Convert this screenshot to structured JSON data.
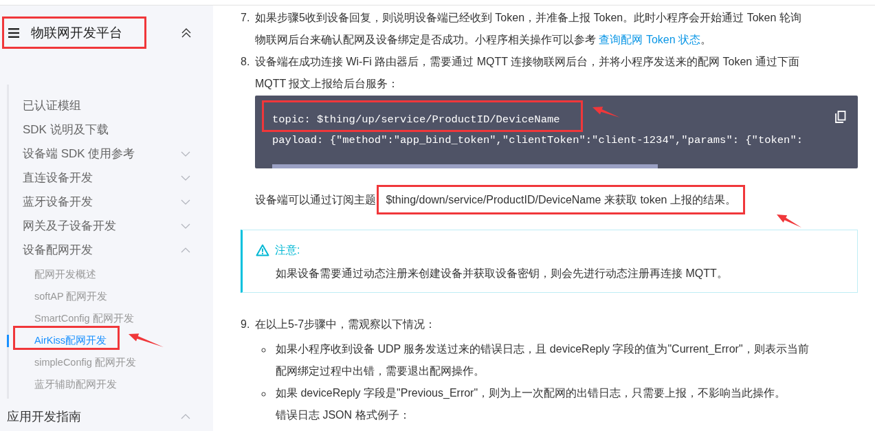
{
  "sidebar": {
    "title": "物联网开发平台",
    "expanded": true,
    "items": [
      {
        "kind": "link",
        "label": "已认证模组"
      },
      {
        "kind": "link",
        "label": "SDK 说明及下载"
      },
      {
        "kind": "group",
        "label": "设备端 SDK 使用参考",
        "expanded": false
      },
      {
        "kind": "group",
        "label": "直连设备开发",
        "expanded": false
      },
      {
        "kind": "group",
        "label": "蓝牙设备开发",
        "expanded": false
      },
      {
        "kind": "group",
        "label": "网关及子设备开发",
        "expanded": false
      },
      {
        "kind": "group",
        "label": "设备配网开发",
        "expanded": true,
        "children": [
          {
            "label": "配网开发概述",
            "selected": false
          },
          {
            "label": "softAP 配网开发",
            "selected": false
          },
          {
            "label": "SmartConfig 配网开发",
            "selected": false
          },
          {
            "label": "AirKiss配网开发",
            "selected": true
          },
          {
            "label": "simpleConfig 配网开发",
            "selected": false
          },
          {
            "label": "蓝牙辅助配网开发",
            "selected": false
          }
        ]
      }
    ],
    "section": {
      "label": "应用开发指南",
      "expanded": true
    }
  },
  "content": {
    "step_7": {
      "number": "7.",
      "text": "如果步骤5收到设备回复，则说明设备端已经收到 Token，并准备上报 Token。此时小程序会开始通过 Token 轮询物联网后台来确认配网及设备绑定是否成功。小程序相关操作可以参考 ",
      "link": "查询配网 Token 状态",
      "after": "。"
    },
    "step_8": {
      "number": "8.",
      "text": "设备端在成功连接 Wi-Fi 路由器后，需要通过 MQTT 连接物联网后台，并将小程序发送来的配网 Token 通过下面 MQTT 报文上报给后台服务："
    },
    "code": [
      "topic: $thing/up/service/ProductID/DeviceName",
      "payload: {\"method\":\"app_bind_token\",\"clientToken\":\"client-1234\",\"params\": {\"token\":"
    ],
    "paragraph": {
      "text": "设备端可以通过订阅主题 ",
      "highlighted": "$thing/down/service/ProductID/DeviceName 来获取 token 上报的结果。"
    },
    "notice": {
      "title": "注意:",
      "text": "如果设备需要通过动态注册来创建设备并获取设备密钥，则会先进行动态注册再连接 MQTT。"
    },
    "step_9": {
      "number": "9.",
      "text": "在以上5-7步骤中，需观察以下情况：",
      "bullets": [
        {
          "text": "如果小程序收到设备 UDP 服务发送过来的错误日志，且 deviceReply 字段的值为\"Current_Error\"，则表示当前配网绑定过程中出错，需要退出配网操作。"
        },
        {
          "text": "如果 deviceReply 字段是\"Previous_Error\"，则为上一次配网的出错日志，只需要上报，不影响当此操作。",
          "note": "错误日志 JSON 格式例子："
        }
      ]
    }
  }
}
